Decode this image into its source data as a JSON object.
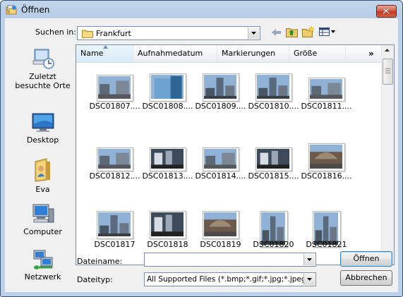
{
  "window": {
    "title": "Öffnen"
  },
  "lookin": {
    "label": "Suchen in:",
    "value": "Frankfurt"
  },
  "places": [
    {
      "label": "Zuletzt besuchte Orte",
      "icon": "recent-places-icon"
    },
    {
      "label": "Desktop",
      "icon": "desktop-icon"
    },
    {
      "label": "Eva",
      "icon": "user-folder-icon"
    },
    {
      "label": "Computer",
      "icon": "computer-icon"
    },
    {
      "label": "Netzwerk",
      "icon": "network-icon"
    }
  ],
  "columns": [
    "Name",
    "Aufnahmedatum",
    "Markierungen",
    "Größe"
  ],
  "more_columns": "»",
  "files": [
    "DSC01807....",
    "DSC01808....",
    "DSC01809....",
    "DSC01810....",
    "DSC01811....",
    "DSC01812....",
    "DSC01813....",
    "DSC01814....",
    "DSC01815....",
    "DSC01816....",
    "DSC01817",
    "DSC01818",
    "DSC01819",
    "DSC01820",
    "DSC01821"
  ],
  "filename": {
    "label": "Dateiname:",
    "value": ""
  },
  "filetype": {
    "label": "Dateityp:",
    "value": "All Supported Files (*.bmp;*.gif;*.jpg;*.jpeg;*.jpe;"
  },
  "buttons": {
    "open": "Öffnen",
    "cancel": "Abbrechen"
  }
}
